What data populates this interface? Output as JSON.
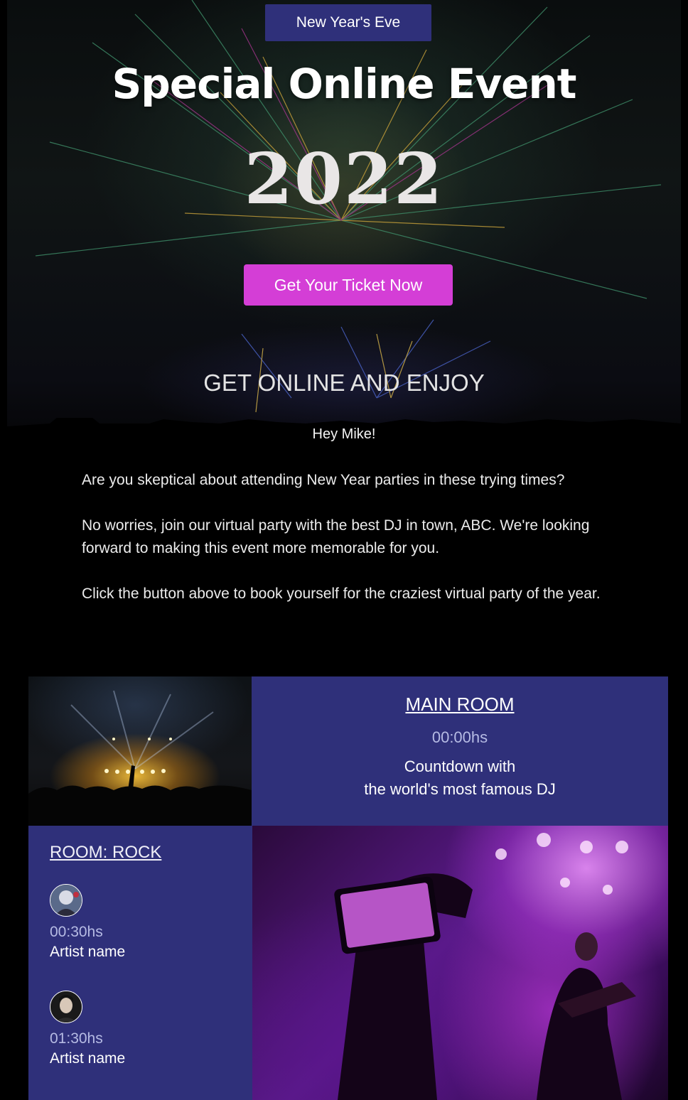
{
  "hero": {
    "badge": "New Year's Eve",
    "title": "Special Online Event",
    "year": "2022",
    "cta_label": "Get Your Ticket Now",
    "subhead": "GET ONLINE AND ENJOY"
  },
  "greeting": "Hey Mike!",
  "body": {
    "paragraphs": [
      "Are you skeptical about attending New Year parties in these trying times?",
      "No worries, join our virtual party with the best DJ in town, ABC. We're looking forward to making this event more memorable for you.",
      "Click the button above to book yourself for the craziest virtual party of the year."
    ]
  },
  "main_room": {
    "title": "MAIN ROOM",
    "time": "00:00hs",
    "desc_line1": "Countdown with",
    "desc_line2": "the world's most famous DJ"
  },
  "rock_room": {
    "title": "ROOM: ROCK",
    "artists": [
      {
        "time": "00:30hs",
        "name": "Artist name"
      },
      {
        "time": "01:30hs",
        "name": "Artist name"
      }
    ]
  },
  "colors": {
    "panel": "#2f307a",
    "cta": "#d43ed6",
    "time_text": "#b6bbe4"
  }
}
